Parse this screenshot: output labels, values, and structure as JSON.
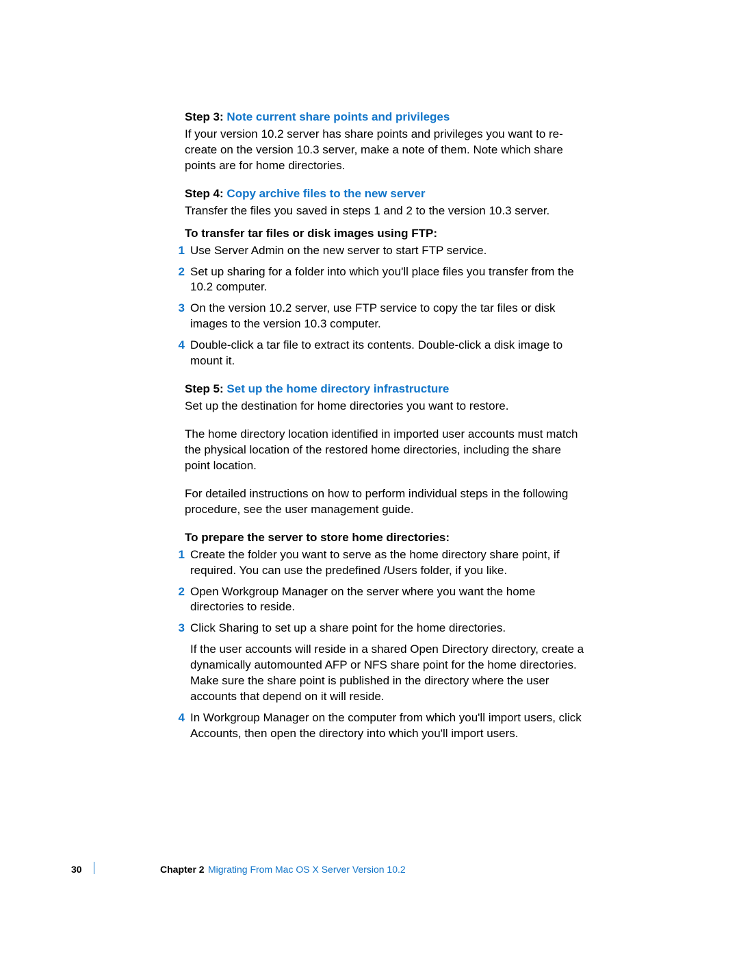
{
  "step3": {
    "label": "Step 3:",
    "title": "Note current share points and privileges",
    "body": "If your version 10.2 server has share points and privileges you want to re-create on the version 10.3 server, make a note of them. Note which share points are for home directories."
  },
  "step4": {
    "label": "Step 4:",
    "title": "Copy archive files to the new server",
    "body": "Transfer the files you saved in steps 1 and 2 to the version 10.3 server.",
    "subhead": "To transfer tar files or disk images using FTP:",
    "items": [
      {
        "n": "1",
        "text": "Use Server Admin on the new server to start FTP service."
      },
      {
        "n": "2",
        "text": "Set up sharing for a folder into which you'll place files you transfer from the 10.2 computer."
      },
      {
        "n": "3",
        "text": "On the version 10.2 server, use FTP service to copy the tar files or disk images to the version 10.3 computer."
      },
      {
        "n": "4",
        "text": "Double-click a tar file to extract its contents. Double-click a disk image to mount it."
      }
    ]
  },
  "step5": {
    "label": "Step 5:",
    "title": "Set up the home directory infrastructure",
    "p1": "Set up the destination for home directories you want to restore.",
    "p2": "The home directory location identified in imported user accounts must match the physical location of the restored home directories, including the share point location.",
    "p3": "For detailed instructions on how to perform individual steps in the following procedure, see the user management guide.",
    "subhead": "To prepare the server to store home directories:",
    "items": [
      {
        "n": "1",
        "text": "Create the folder you want to serve as the home directory share point, if required. You can use the predefined /Users folder, if you like."
      },
      {
        "n": "2",
        "text": "Open Workgroup Manager on the server where you want the home directories to reside."
      },
      {
        "n": "3",
        "text": "Click Sharing to set up a share point for the home directories.",
        "extra": "If the user accounts will reside in a shared Open Directory directory, create a dynamically automounted AFP or NFS share point for the home directories. Make sure the share point is published in the directory where the user accounts that depend on it will reside."
      },
      {
        "n": "4",
        "text": "In Workgroup Manager on the computer from which you'll import users, click Accounts, then open the directory into which you'll import users."
      }
    ]
  },
  "footer": {
    "page": "30",
    "chapter": "Chapter 2",
    "title": "Migrating From Mac OS X Server Version 10.2"
  }
}
